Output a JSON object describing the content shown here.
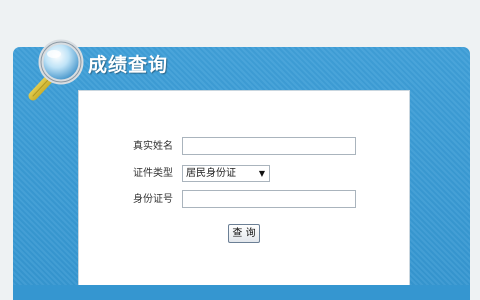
{
  "header": {
    "title": "成绩查询"
  },
  "form": {
    "name_label": "真实姓名",
    "name_value": "",
    "id_type_label": "证件类型",
    "id_type_selected": "居民身份证",
    "id_number_label": "身份证号",
    "id_number_value": "",
    "submit_label": "查 询"
  },
  "colors": {
    "panel_blue": "#3596d0",
    "background": "#eef2f3"
  },
  "icons": {
    "title_icon": "magnifier-icon",
    "select_arrow": "triangle-down-icon"
  }
}
